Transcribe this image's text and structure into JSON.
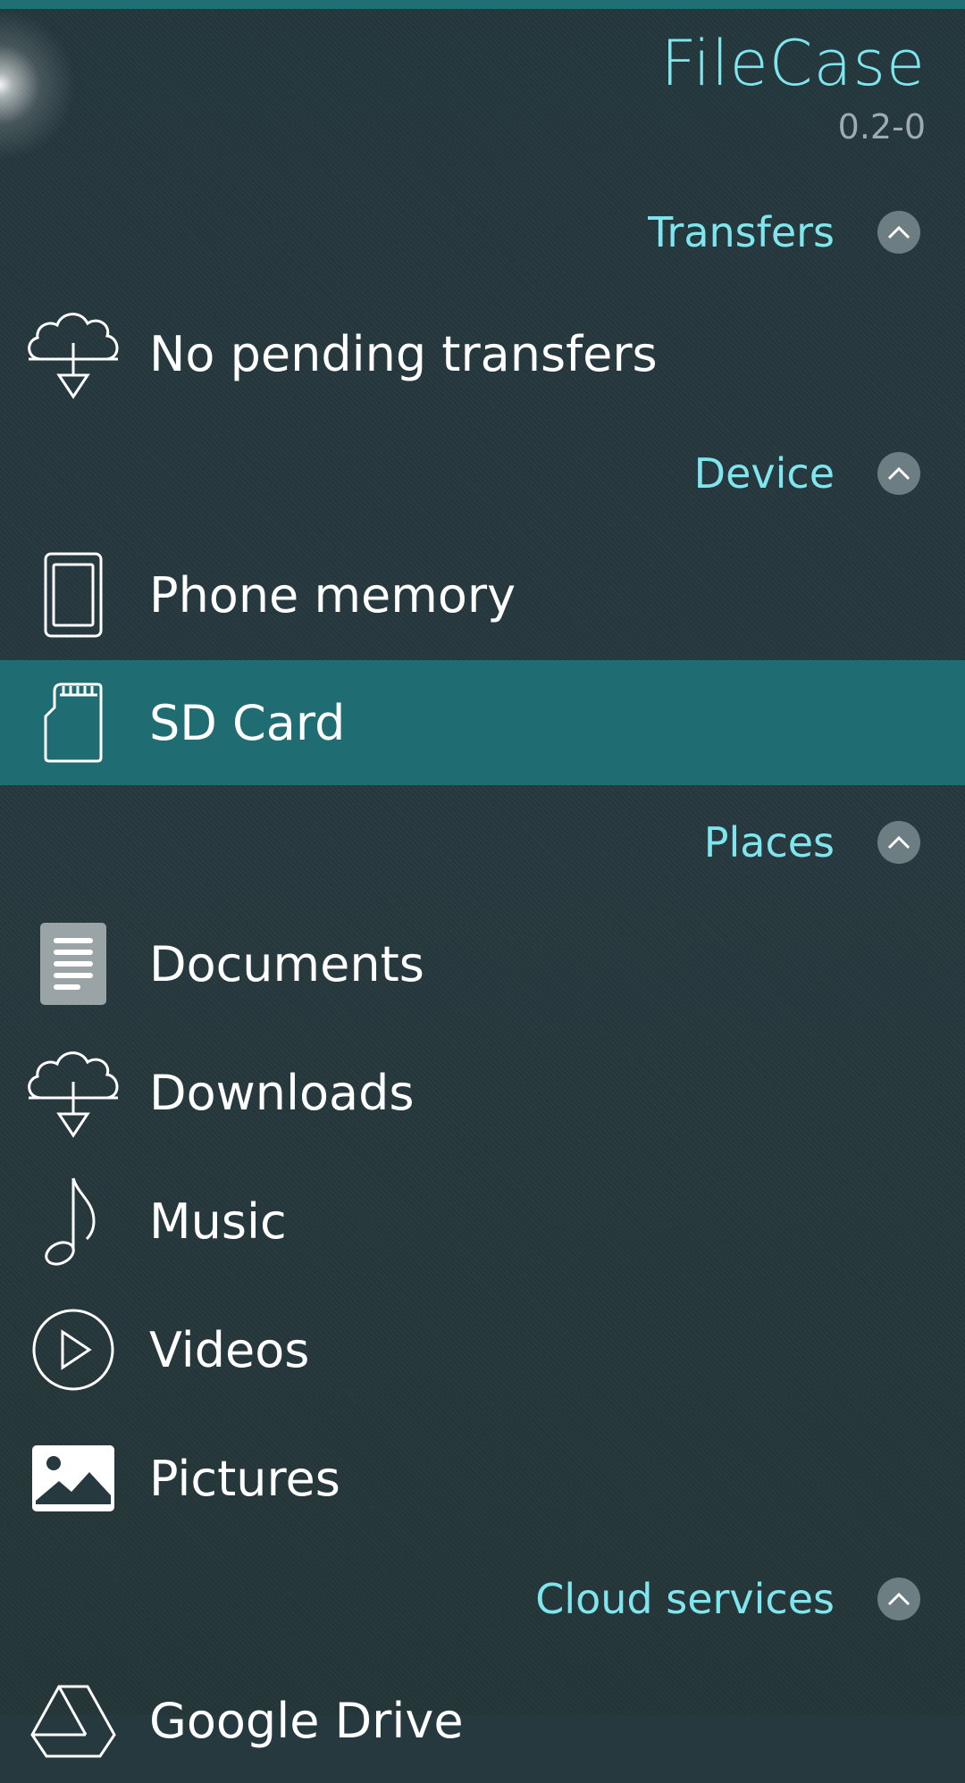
{
  "app": {
    "title": "FileCase",
    "version": "0.2-0"
  },
  "sections": {
    "transfers": {
      "label": "Transfers",
      "items": [
        {
          "label": "No pending transfers",
          "icon": "cloud-download-icon"
        }
      ]
    },
    "device": {
      "label": "Device",
      "items": [
        {
          "label": "Phone memory",
          "icon": "phone-icon"
        },
        {
          "label": "SD Card",
          "icon": "sd-card-icon",
          "selected": true
        }
      ]
    },
    "places": {
      "label": "Places",
      "items": [
        {
          "label": "Documents",
          "icon": "document-icon"
        },
        {
          "label": "Downloads",
          "icon": "cloud-download-icon"
        },
        {
          "label": "Music",
          "icon": "music-note-icon"
        },
        {
          "label": "Videos",
          "icon": "play-circle-icon"
        },
        {
          "label": "Pictures",
          "icon": "picture-icon"
        }
      ]
    },
    "cloud": {
      "label": "Cloud services",
      "items": [
        {
          "label": "Google Drive",
          "icon": "google-drive-icon"
        }
      ]
    }
  },
  "colors": {
    "accent": "#7fe6ef",
    "highlight": "#1f6d73",
    "background": "#26393f"
  }
}
